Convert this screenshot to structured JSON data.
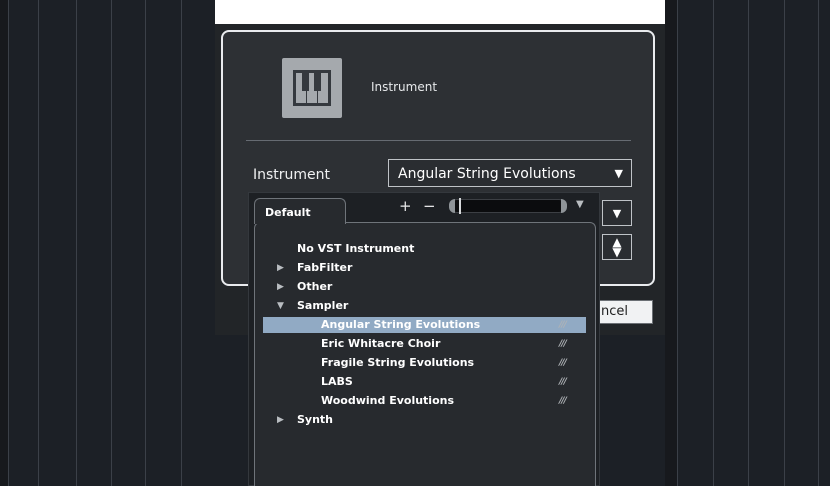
{
  "dialog": {
    "header_label": "Instrument",
    "field_label": "Instrument",
    "selected_instrument": "Angular String Evolutions",
    "cancel_label": "ncel"
  },
  "browser": {
    "tab_label": "Default",
    "add_label": "+",
    "remove_label": "−",
    "items": [
      {
        "label": "No VST Instrument",
        "level": 0,
        "expander": "",
        "mark": ""
      },
      {
        "label": "FabFilter",
        "level": 0,
        "expander": "▶",
        "mark": ""
      },
      {
        "label": "Other",
        "level": 0,
        "expander": "▶",
        "mark": ""
      },
      {
        "label": "Sampler",
        "level": 0,
        "expander": "▼",
        "mark": ""
      },
      {
        "label": "Angular String Evolutions",
        "level": 1,
        "expander": "",
        "mark": "///",
        "selected": true
      },
      {
        "label": "Eric Whitacre Choir",
        "level": 1,
        "expander": "",
        "mark": "///"
      },
      {
        "label": "Fragile String Evolutions",
        "level": 1,
        "expander": "",
        "mark": "///"
      },
      {
        "label": "LABS",
        "level": 1,
        "expander": "",
        "mark": "///"
      },
      {
        "label": "Woodwind Evolutions",
        "level": 1,
        "expander": "",
        "mark": "///"
      },
      {
        "label": "Synth",
        "level": 0,
        "expander": "▶",
        "mark": ""
      }
    ]
  },
  "colors": {
    "background": "#1c2026",
    "selection": "#91aac4",
    "dialog_border": "#e9ebee"
  },
  "icons": {
    "instrument": "piano-keys-icon",
    "dropdown": "triangle-down-icon",
    "spinner": "up-down-arrows-icon",
    "expand": "triangle-right-icon",
    "collapse": "triangle-down-icon"
  }
}
